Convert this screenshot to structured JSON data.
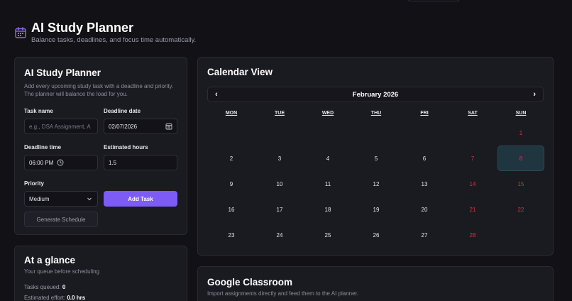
{
  "header": {
    "title": "AI Study Planner",
    "subtitle": "Balance tasks, deadlines, and focus time automatically."
  },
  "form": {
    "title": "AI Study Planner",
    "description": "Add every upcoming study task with a deadline and priority. The planner will balance the load for you.",
    "task_name_label": "Task name",
    "task_name_placeholder": "e.g., DSA Assignment, A",
    "deadline_date_label": "Deadline date",
    "deadline_date_value": "02/07/2026",
    "deadline_time_label": "Deadline time",
    "deadline_time_value": "06:00 PM",
    "estimated_hours_label": "Estimated hours",
    "estimated_hours_value": "1.5",
    "priority_label": "Priority",
    "priority_value": "Medium",
    "add_task_label": "Add Task",
    "generate_label": "Generate Schedule"
  },
  "calendar": {
    "title": "Calendar View",
    "month_label": "February 2026",
    "prev_label": "‹",
    "next_label": "›",
    "weekdays": [
      "MON",
      "TUE",
      "WED",
      "THU",
      "FRI",
      "SAT",
      "SUN"
    ],
    "leading_blanks": 6,
    "days": 28,
    "today": 8
  },
  "glance": {
    "title": "At a glance",
    "subtitle": "Your queue before scheduling",
    "tasks_queued_label": "Tasks queued:",
    "tasks_queued_value": "0",
    "effort_label": "Estimated effort:",
    "effort_value": "0.0 hrs"
  },
  "classroom": {
    "title": "Google Classroom",
    "description": "Import assignments directly and feed them to the AI planner."
  },
  "colors": {
    "accent": "#7c5cf5",
    "weekend": "#d33838",
    "today_bg": "#1f3540"
  }
}
